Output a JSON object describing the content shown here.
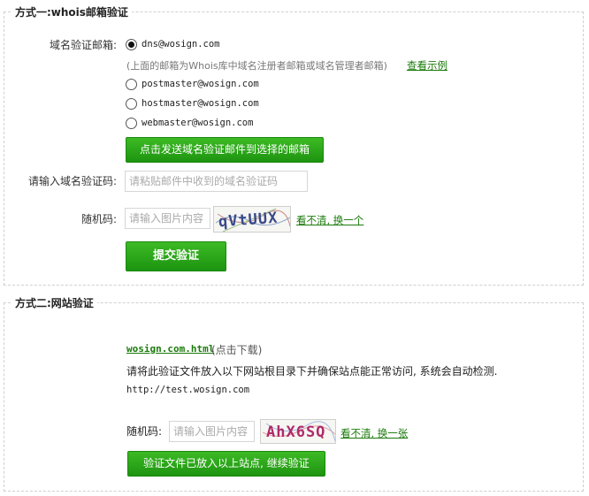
{
  "method1": {
    "title": "方式一:whois邮箱验证",
    "email_label": "域名验证邮箱:",
    "email_options": [
      {
        "value": "dns@wosign.com",
        "checked": true
      },
      {
        "value": "postmaster@wosign.com",
        "checked": false
      },
      {
        "value": "hostmaster@wosign.com",
        "checked": false
      },
      {
        "value": "webmaster@wosign.com",
        "checked": false
      }
    ],
    "hint": "(上面的邮箱为Whois库中域名注册者邮箱或域名管理者邮箱)",
    "hint_link": "查看示例",
    "send_button": "点击发送域名验证邮件到选择的邮箱",
    "code_label": "请输入域名验证码:",
    "code_placeholder": "请粘贴邮件中收到的域名验证码",
    "captcha_label": "随机码:",
    "captcha_placeholder": "请输入图片内容",
    "captcha_text": "qVtUUX",
    "refresh_link": "看不清, 换一个",
    "submit_button": "提交验证"
  },
  "method2": {
    "title": "方式二:网站验证",
    "file_link": "wosign.com.html",
    "file_note": "(点击下载)",
    "instruction": "请将此验证文件放入以下网站根目录下并确保站点能正常访问, 系统会自动检测.",
    "site_url": "http://test.wosign.com",
    "captcha_label": "随机码:",
    "captcha_placeholder": "请输入图片内容",
    "captcha_text": "AhX6SQ",
    "refresh_link": "看不清, 换一张",
    "continue_button": "验证文件已放入以上站点, 继续验证"
  },
  "colors": {
    "accent_green": "#1d9410",
    "link_green": "#1a7a0a"
  }
}
